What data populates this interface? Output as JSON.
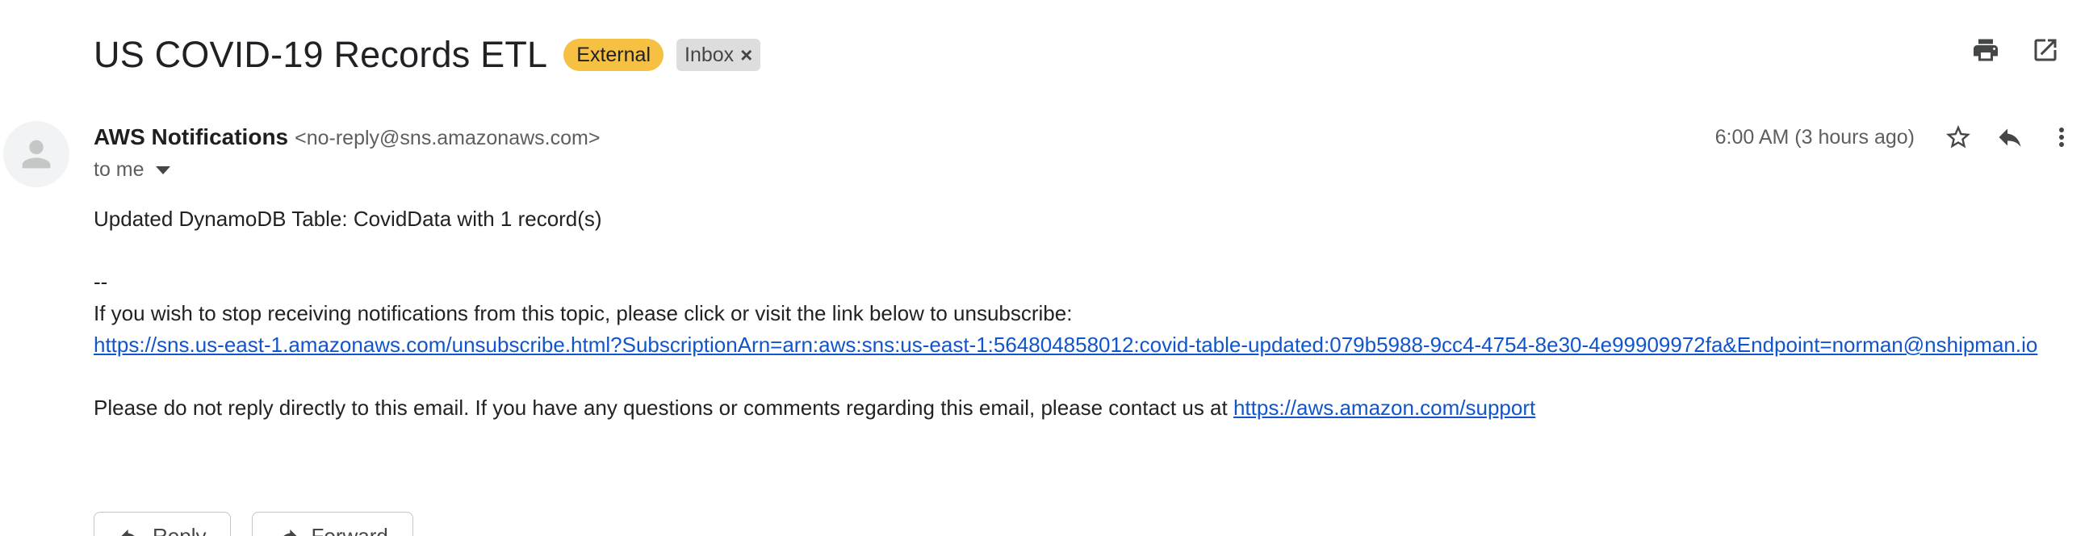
{
  "header": {
    "subject": "US COVID-19 Records ETL",
    "labels": {
      "external": "External",
      "inbox": "Inbox",
      "inbox_remove": "×"
    },
    "icons": [
      "print-icon",
      "open-in-new-window-icon"
    ]
  },
  "message": {
    "sender_name": "AWS Notifications",
    "sender_email": "<no-reply@sns.amazonaws.com>",
    "recipient": "to me",
    "timestamp": "6:00 AM (3 hours ago)",
    "icons": [
      "star-icon",
      "reply-icon",
      "more-options-icon"
    ],
    "body": {
      "line1": "Updated DynamoDB Table: CovidData with 1 record(s)",
      "separator": "--",
      "unsubscribe_text": "If you wish to stop receiving notifications from this topic, please click or visit the link below to unsubscribe:",
      "unsubscribe_link": "https://sns.us-east-1.amazonaws.com/unsubscribe.html?SubscriptionArn=arn:aws:sns:us-east-1:564804858012:covid-table-updated:079b5988-9cc4-4754-8e30-4e99909972fa&Endpoint=norman@nshipman.io",
      "disclaimer_text": "Please do not reply directly to this email. If you have any questions or comments regarding this email, please contact us at ",
      "support_link": "https://aws.amazon.com/support"
    }
  },
  "actions": {
    "reply": "Reply",
    "forward": "Forward"
  },
  "colors": {
    "external_badge": "#f6c142",
    "inbox_badge": "#dddddd",
    "link": "#1155cc"
  }
}
